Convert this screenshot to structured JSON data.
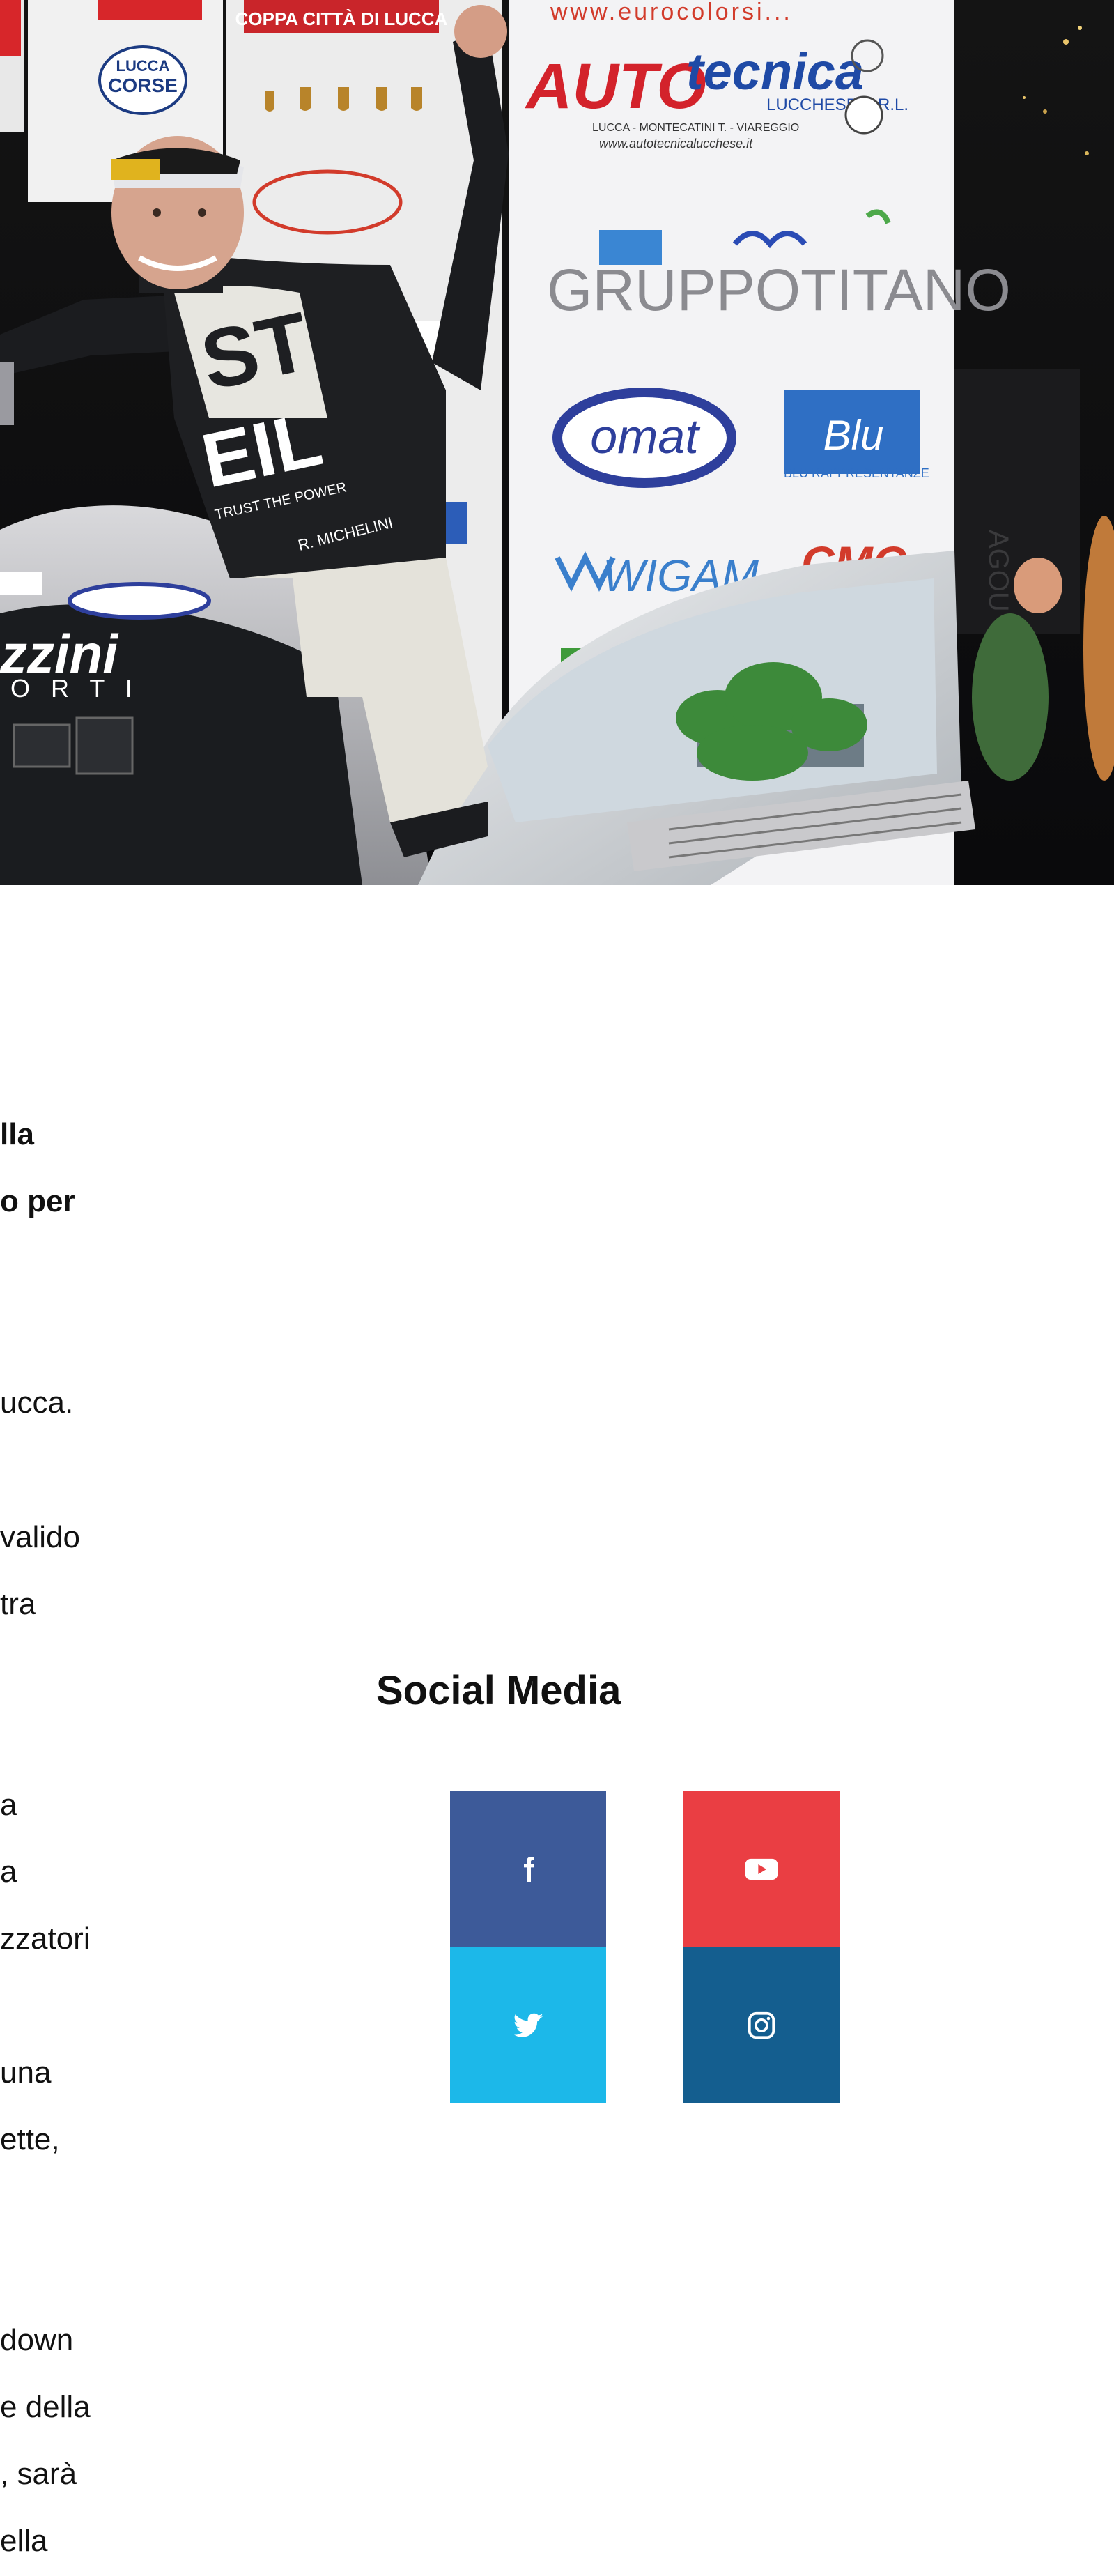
{
  "hero": {
    "banner_top": "COPPA CITTÀ DI LUCCA",
    "url_text": "www.eurocolorsi...",
    "lucca_corse": [
      "LUCCA",
      "CORSE"
    ],
    "autotecnica": {
      "name_red": "AUTO",
      "name_blue": "tecnica",
      "subtitle": "LUCCHESE S.R.L.",
      "address": "LUCCA - MONTECATINI T. - VIAREGGIO",
      "website": "www.autotecnicalucchese.it"
    },
    "gruppotitano": "GRUPPOTITANO",
    "omat": "omat",
    "blu": {
      "name": "Blu",
      "tag": "BLU RAPPRESENTANZE"
    },
    "wigam": "WIGAM",
    "cmc": "CMC",
    "suit": {
      "brand_st": "ST",
      "brand_eil": "EIL",
      "tagline": "TRUST THE POWER",
      "name_patch": "R. MICHELINI"
    },
    "car_text": "zzini",
    "car_sub": "O R T I"
  },
  "article": {
    "fragments": [
      {
        "text": "lla",
        "bold": true
      },
      {
        "text": "o per",
        "bold": true
      },
      {
        "text": "ucca.",
        "bold": false
      },
      {
        "text": "valido",
        "bold": false
      },
      {
        "text": " tra",
        "bold": false
      },
      {
        "text": "a",
        "bold": false
      },
      {
        "text": "a",
        "bold": false
      },
      {
        "text": "zzatori",
        "bold": false
      },
      {
        "text": "una",
        "bold": false
      },
      {
        "text": "ette,",
        "bold": false
      },
      {
        "text": "down",
        "bold": false
      },
      {
        "text": "e della",
        "bold": false
      },
      {
        "text": ", sarà",
        "bold": false
      },
      {
        "text": "ella",
        "bold": false
      }
    ]
  },
  "social": {
    "title": "Social Media",
    "items": [
      {
        "name": "facebook",
        "icon": "facebook-icon",
        "color": "#3d5a99"
      },
      {
        "name": "youtube",
        "icon": "youtube-icon",
        "color": "#ea3e43"
      },
      {
        "name": "twitter",
        "icon": "twitter-icon",
        "color": "#1cb8e9"
      },
      {
        "name": "instagram",
        "icon": "instagram-icon",
        "color": "#145e8f"
      }
    ]
  }
}
